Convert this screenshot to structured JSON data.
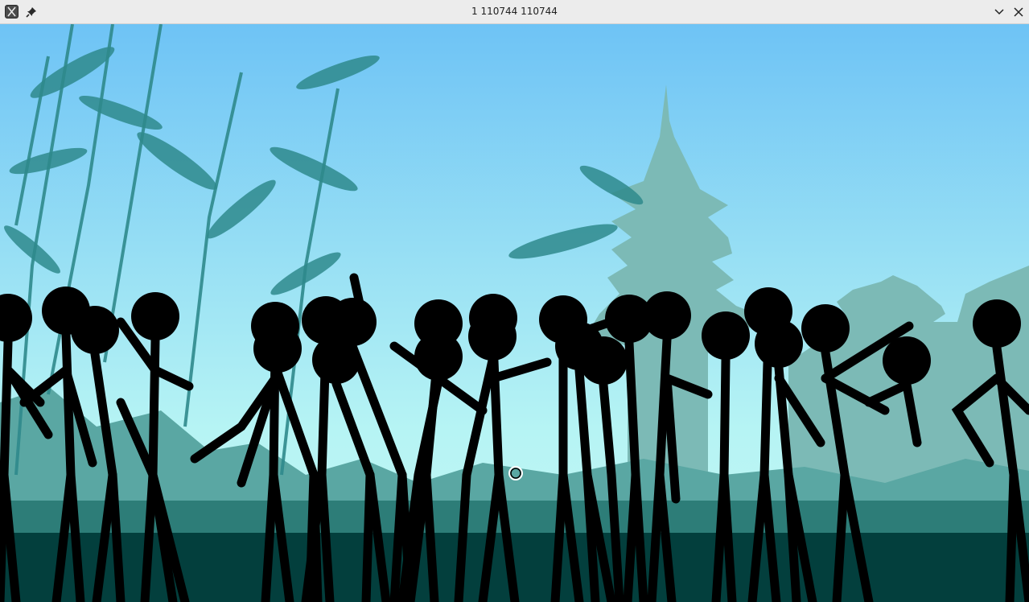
{
  "window": {
    "title": "1 110744 110744",
    "app_icon": "x-app-icon",
    "pin_icon": "pin-icon",
    "minimize_icon": "chevron-down-icon",
    "close_icon": "close-icon"
  },
  "scene": {
    "description_icon": "game-scene",
    "colors": {
      "sky_top": "#6ec3f5",
      "sky_bottom": "#b6f4f4",
      "silhouette_far": "#7cbab6",
      "silhouette_mid": "#4f9c98",
      "bamboo": "#2f8a8c",
      "ground_mid": "#2d7d78",
      "ground_dark": "#033f3d",
      "stickman": "#000000"
    }
  }
}
